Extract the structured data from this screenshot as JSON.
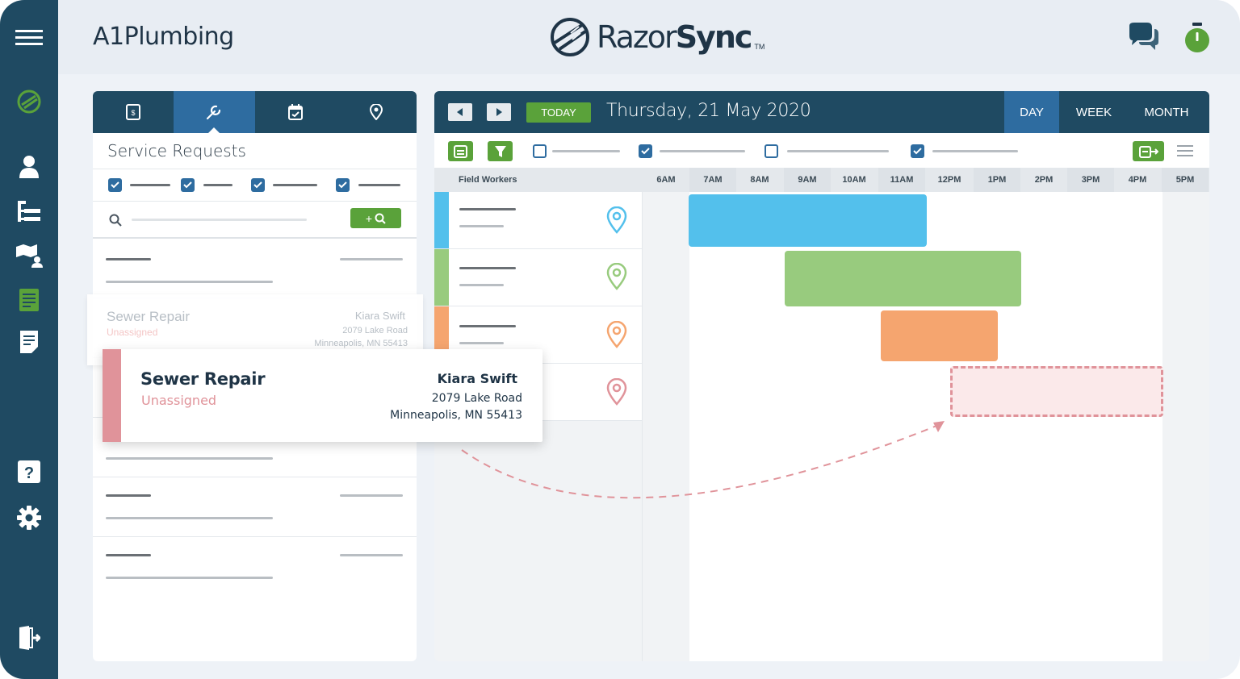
{
  "header": {
    "org_name": "A1Plumbing",
    "brand_prefix": "Razor",
    "brand_suffix": "Sync",
    "brand_tm": "TM"
  },
  "rail": {
    "items": [
      {
        "name": "menu-icon"
      },
      {
        "name": "logo-icon"
      },
      {
        "name": "customers-icon"
      },
      {
        "name": "hierarchy-icon"
      },
      {
        "name": "map-user-icon"
      },
      {
        "name": "service-requests-icon"
      },
      {
        "name": "document-icon"
      },
      {
        "name": "help-icon"
      },
      {
        "name": "settings-icon"
      },
      {
        "name": "logout-icon"
      }
    ],
    "active_color": "#5aa23a"
  },
  "left_panel": {
    "tabs": [
      "invoice-icon",
      "wrench-icon",
      "calendar-icon",
      "location-icon"
    ],
    "active_tab": 1,
    "title": "Service Requests",
    "add_button_label": "+"
  },
  "ghost_card": {
    "title": "Sewer Repair",
    "status": "Unassigned",
    "worker": "Kiara Swift",
    "address1": "2079 Lake Road",
    "address2": "Minneapolis, MN 55413"
  },
  "card": {
    "title": "Sewer Repair",
    "status": "Unassigned",
    "worker": "Kiara Swift",
    "address1": "2079 Lake Road",
    "address2": "Minneapolis, MN 55413",
    "accent": "#e0939a"
  },
  "scheduler": {
    "today_label": "TODAY",
    "date": "Thursday, 21 May 2020",
    "views": [
      "DAY",
      "WEEK",
      "MONTH"
    ],
    "active_view": "DAY",
    "field_workers_label": "Field Workers",
    "hours": [
      "6AM",
      "7AM",
      "8AM",
      "9AM",
      "10AM",
      "11AM",
      "12PM",
      "1PM",
      "2PM",
      "3PM",
      "4PM",
      "5PM"
    ],
    "workers": [
      {
        "color": "#53c0ec"
      },
      {
        "color": "#98cb7e"
      },
      {
        "color": "#f5a56f"
      },
      {
        "color": "#e0939a"
      }
    ]
  },
  "colors": {
    "navy": "#1f4a62",
    "blue": "#2e6ca0",
    "green": "#5aa23a",
    "job_blue": "#53c0ec",
    "job_green": "#98cb7e",
    "job_orange": "#f5a56f",
    "job_pink": "#e0939a"
  }
}
